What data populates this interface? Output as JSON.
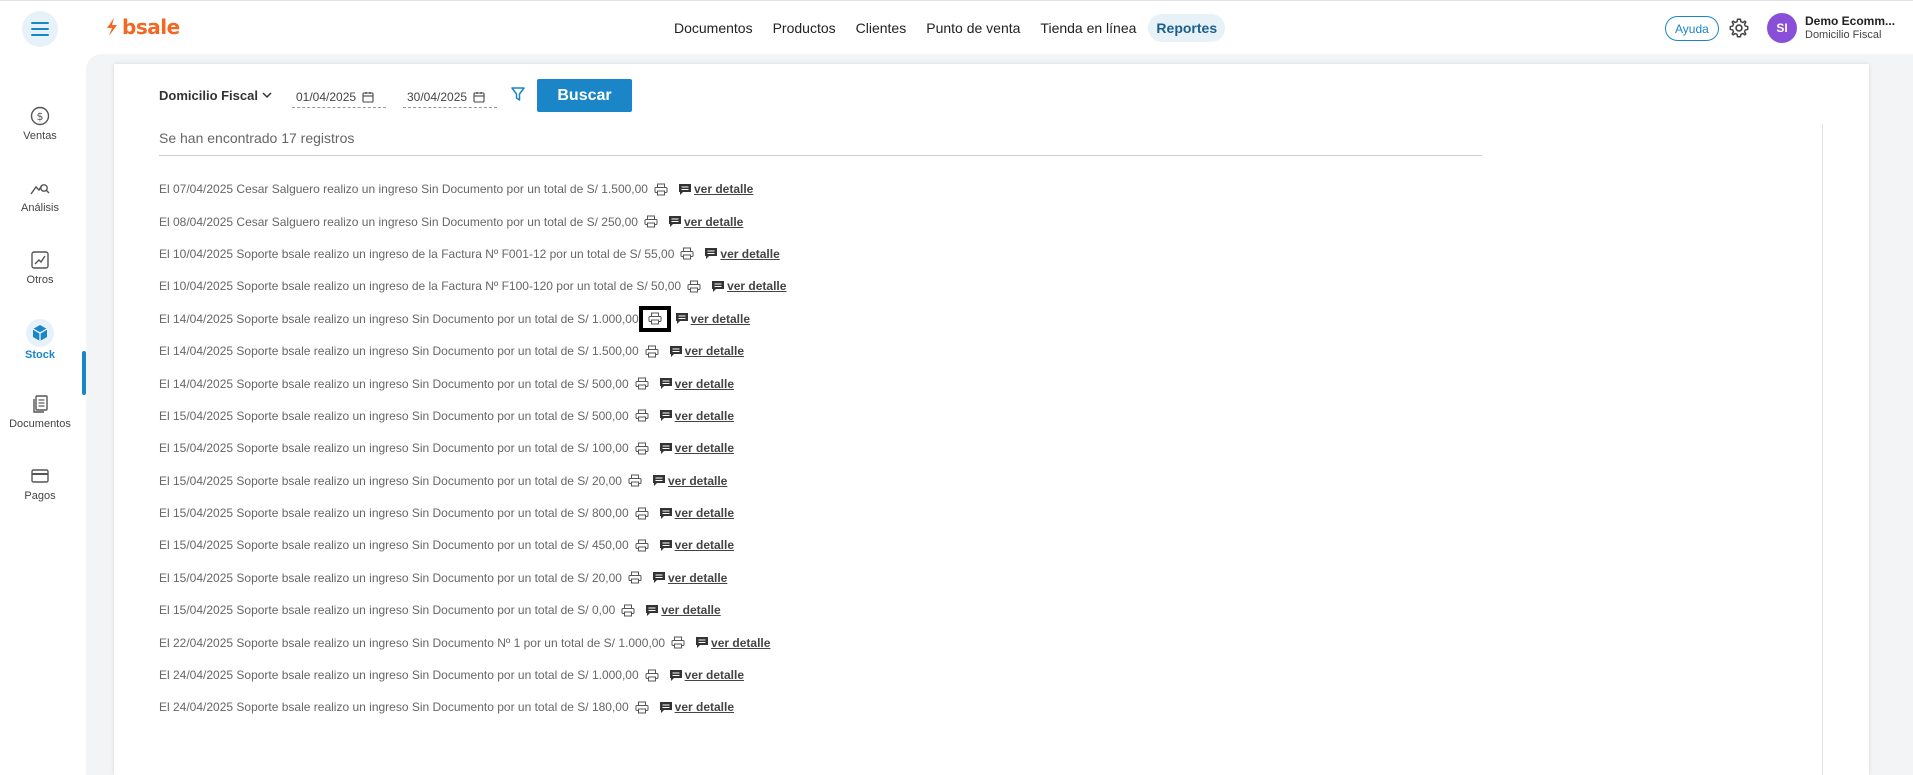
{
  "header": {
    "logo_text": "bsale",
    "nav": [
      "Documentos",
      "Productos",
      "Clientes",
      "Punto de venta",
      "Tienda en línea",
      "Reportes"
    ],
    "active_nav": "Reportes",
    "help_label": "Ayuda",
    "avatar_initials": "SI",
    "user_name": "Demo Ecomm...",
    "user_sub": "Domicilio Fiscal"
  },
  "sidebar": {
    "items": [
      {
        "label": "Ventas",
        "icon": "dollar-icon"
      },
      {
        "label": "Análisis",
        "icon": "analysis-icon"
      },
      {
        "label": "Otros",
        "icon": "chart-icon"
      },
      {
        "label": "Stock",
        "icon": "box-icon"
      },
      {
        "label": "Documentos",
        "icon": "documents-icon"
      },
      {
        "label": "Pagos",
        "icon": "card-icon"
      }
    ],
    "active": "Stock"
  },
  "filters": {
    "branch": "Domicilio Fiscal",
    "date_from": "01/04/2025",
    "date_to": "30/04/2025",
    "search_label": "Buscar"
  },
  "results": {
    "summary": "Se han encontrado 17 registros",
    "detail_label": "ver detalle",
    "rows": [
      "El 07/04/2025 Cesar Salguero realizo un ingreso Sin Documento por un total de S/ 1.500,00",
      "El 08/04/2025 Cesar Salguero realizo un ingreso Sin Documento por un total de S/ 250,00",
      "El 10/04/2025 Soporte bsale realizo un ingreso de la Factura Nº F001-12 por un total de S/ 55,00",
      "El 10/04/2025 Soporte bsale realizo un ingreso de la Factura Nº F100-120 por un total de S/ 50,00",
      "El 14/04/2025 Soporte bsale realizo un ingreso Sin Documento por un total de S/ 1.000,00",
      "El 14/04/2025 Soporte bsale realizo un ingreso Sin Documento por un total de S/ 1.500,00",
      "El 14/04/2025 Soporte bsale realizo un ingreso Sin Documento por un total de S/ 500,00",
      "El 15/04/2025 Soporte bsale realizo un ingreso Sin Documento por un total de S/ 500,00",
      "El 15/04/2025 Soporte bsale realizo un ingreso Sin Documento por un total de S/ 100,00",
      "El 15/04/2025 Soporte bsale realizo un ingreso Sin Documento por un total de S/ 20,00",
      "El 15/04/2025 Soporte bsale realizo un ingreso Sin Documento por un total de S/ 800,00",
      "El 15/04/2025 Soporte bsale realizo un ingreso Sin Documento por un total de S/ 450,00",
      "El 15/04/2025 Soporte bsale realizo un ingreso Sin Documento por un total de S/ 20,00",
      "El 15/04/2025 Soporte bsale realizo un ingreso Sin Documento por un total de S/ 0,00",
      "El 22/04/2025 Soporte bsale realizo un ingreso Sin Documento Nº 1 por un total de S/ 1.000,00",
      "El 24/04/2025 Soporte bsale realizo un ingreso Sin Documento por un total de S/ 1.000,00",
      "El 24/04/2025 Soporte bsale realizo un ingreso Sin Documento por un total de S/ 180,00"
    ],
    "highlighted_row": 4
  },
  "colors": {
    "accent": "#1a86c7",
    "brand": "#f26722",
    "avatar": "#8a4fd8"
  }
}
